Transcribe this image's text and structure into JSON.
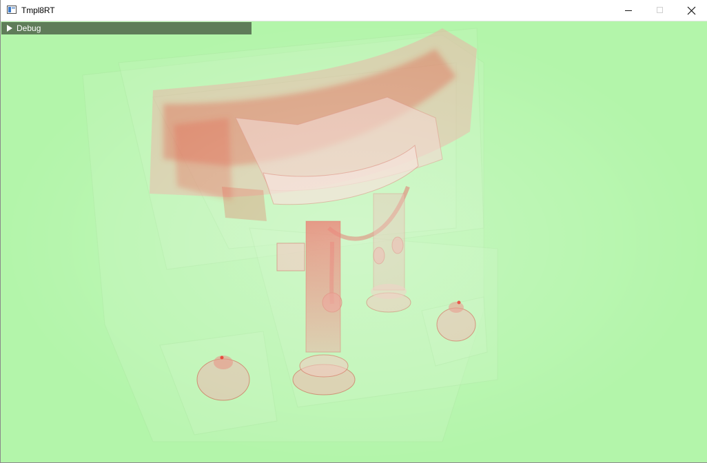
{
  "window": {
    "title": "Tmpl8RT",
    "icon": "app-window-icon",
    "controls": [
      "minimize-icon",
      "maximize-icon",
      "close-icon"
    ]
  },
  "debug_panel": {
    "label": "Debug",
    "expanded": false,
    "arrow_icon": "triangle-right-icon"
  },
  "viewport": {
    "background_color": "#b3f5aa",
    "highlight_color": "#e53c2c",
    "panel_color": "#5f7c59"
  }
}
